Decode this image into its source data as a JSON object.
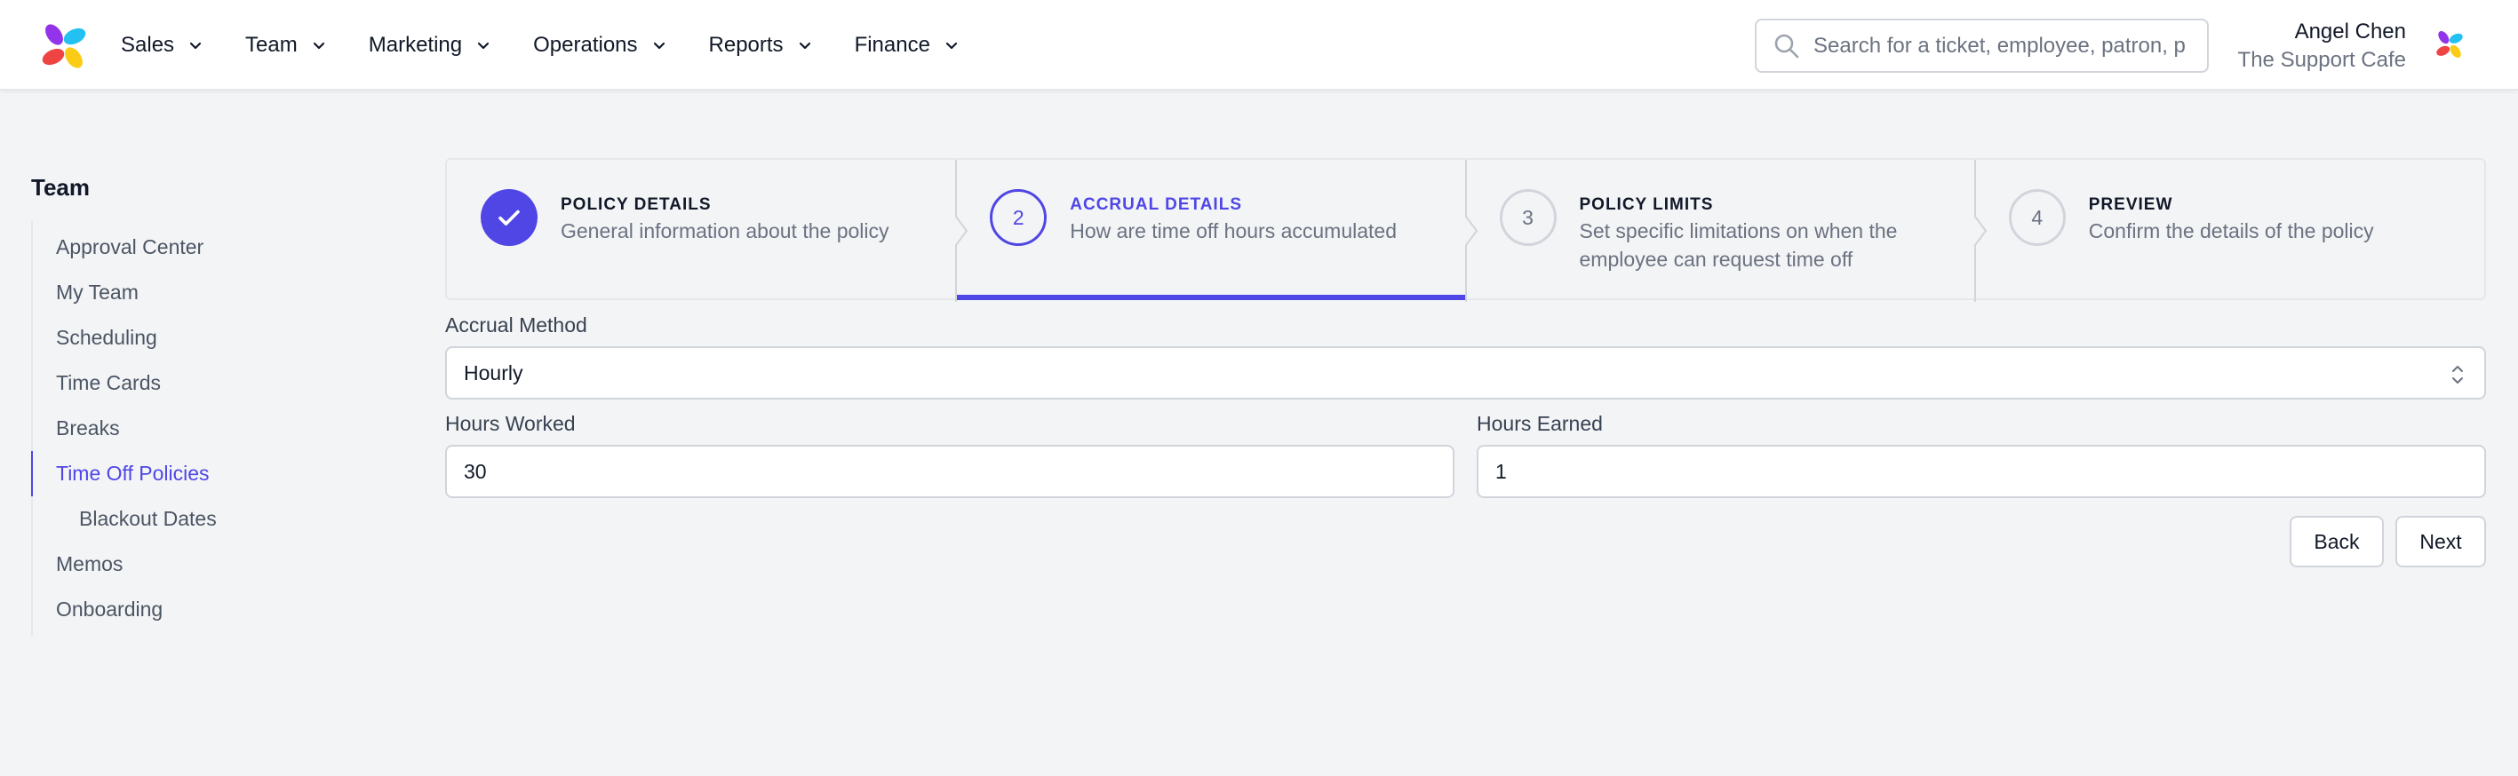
{
  "nav": {
    "items": [
      {
        "label": "Sales"
      },
      {
        "label": "Team"
      },
      {
        "label": "Marketing"
      },
      {
        "label": "Operations"
      },
      {
        "label": "Reports"
      },
      {
        "label": "Finance"
      }
    ],
    "search_placeholder": "Search for a ticket, employee, patron, p",
    "user_name": "Angel Chen",
    "user_org": "The Support Cafe",
    "icons": {
      "logo": "app-logo-icon",
      "search": "search-icon",
      "chevron": "chevron-down-icon",
      "avatar": "org-avatar-icon"
    }
  },
  "sidebar": {
    "title": "Team",
    "items": [
      {
        "label": "Approval Center"
      },
      {
        "label": "My Team"
      },
      {
        "label": "Scheduling"
      },
      {
        "label": "Time Cards"
      },
      {
        "label": "Breaks"
      },
      {
        "label": "Time Off Policies"
      },
      {
        "label": "Blackout Dates"
      },
      {
        "label": "Memos"
      },
      {
        "label": "Onboarding"
      }
    ],
    "active_item": "Time Off Policies"
  },
  "stepper": {
    "steps": [
      {
        "number": "1",
        "title": "POLICY DETAILS",
        "description": "General information about the policy",
        "status": "complete"
      },
      {
        "number": "2",
        "title": "ACCRUAL DETAILS",
        "description": "How are time off hours accumulated",
        "status": "current"
      },
      {
        "number": "3",
        "title": "POLICY LIMITS",
        "description": "Set specific limitations on when the employee can request time off",
        "status": "upcoming"
      },
      {
        "number": "4",
        "title": "PREVIEW",
        "description": "Confirm the details of the policy",
        "status": "upcoming"
      }
    ]
  },
  "form": {
    "accrual_method_label": "Accrual Method",
    "accrual_method_value": "Hourly",
    "hours_worked_label": "Hours Worked",
    "hours_worked_value": "30",
    "hours_earned_label": "Hours Earned",
    "hours_earned_value": "1"
  },
  "buttons": {
    "back": "Back",
    "next": "Next"
  },
  "colors": {
    "accent": "#4f46e5",
    "background": "#f3f4f6",
    "logo": [
      "#9333ea",
      "#22c1f1",
      "#ef4444",
      "#facc15"
    ]
  }
}
